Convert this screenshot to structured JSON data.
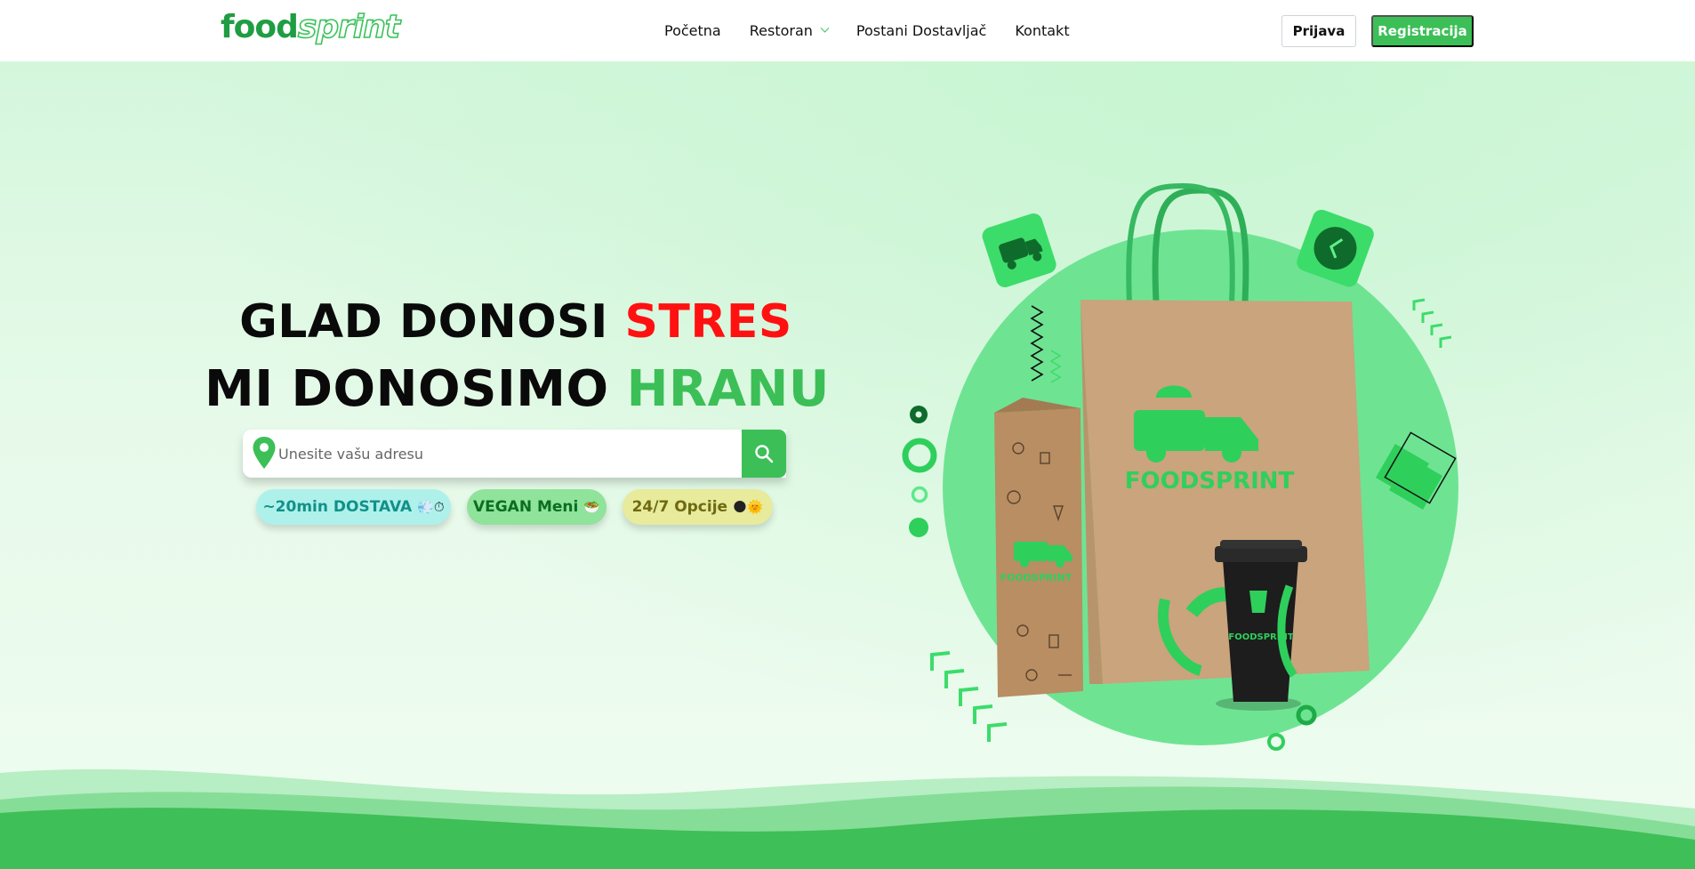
{
  "brand": {
    "part1": "food",
    "part2": "sprint"
  },
  "nav": {
    "items": [
      {
        "label": "Početna"
      },
      {
        "label": "Restoran",
        "has_dropdown": true
      },
      {
        "label": "Postani Dostavljač"
      },
      {
        "label": "Kontakt"
      }
    ]
  },
  "auth": {
    "login": "Prijava",
    "register": "Registracija"
  },
  "hero": {
    "line1_part1": "GLAD DONOSI ",
    "line1_part2": "STRES",
    "line2_part1": "MI DONOSIMO ",
    "line2_part2": "HRANU"
  },
  "search": {
    "placeholder": "Unesite vašu adresu"
  },
  "pills": [
    {
      "label": "~20min DOSTAVA",
      "emoji": "💨⏱"
    },
    {
      "label": "VEGAN Meni",
      "emoji": "🥗"
    },
    {
      "label": "24/7 Opcije",
      "emoji": "🌑🌞"
    }
  ],
  "illustration": {
    "bag_text": "FOODSPRINT",
    "cup_text": "FOODSPRINT"
  },
  "colors": {
    "brand_green": "#3cbf57",
    "dark_green": "#1f9d43",
    "accent_red": "#ff1111",
    "hero_bg": "#e2f9e6"
  }
}
